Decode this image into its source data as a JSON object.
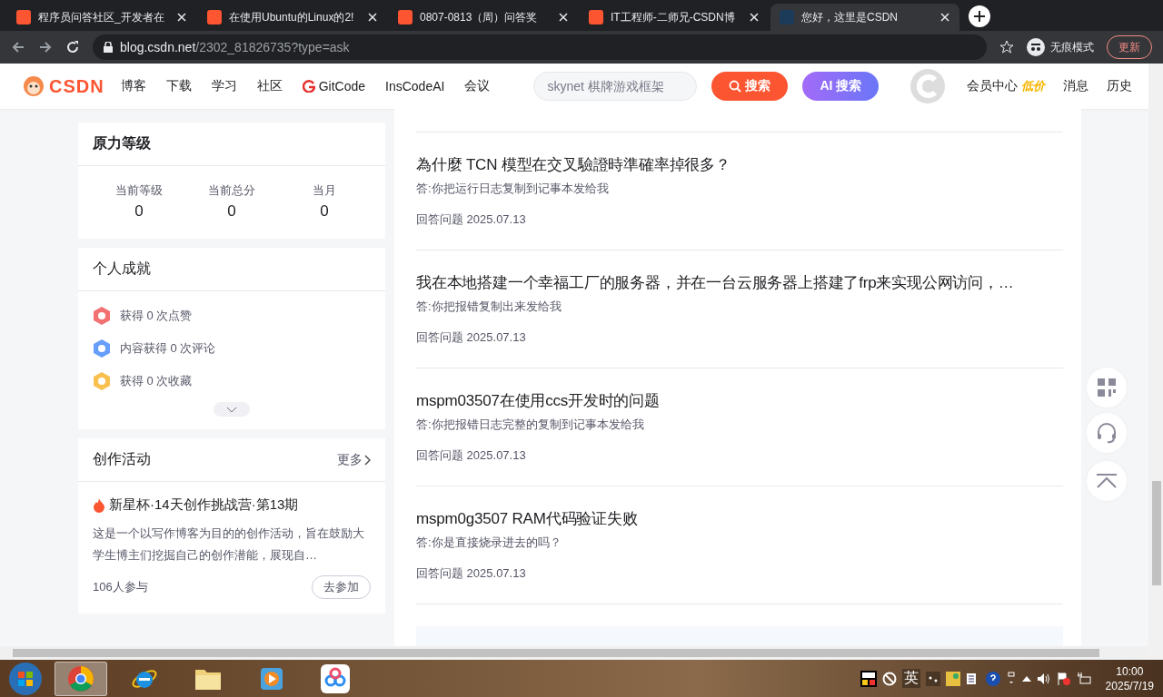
{
  "browser": {
    "tabs": [
      {
        "title": "程序员问答社区_开发者在",
        "selected": false
      },
      {
        "title": "在使用Ubuntu的Linux的2!",
        "selected": false
      },
      {
        "title": "0807-0813（周）问答奖",
        "selected": false
      },
      {
        "title": "IT工程师-二师兄-CSDN博",
        "selected": false
      },
      {
        "title": "您好，这里是CSDN",
        "selected": true
      }
    ],
    "url_host": "blog.csdn.net",
    "url_path": "/2302_81826735?type=ask",
    "incognito_label": "无痕模式",
    "update_label": "更新"
  },
  "header": {
    "logo": "CSDN",
    "nav": [
      {
        "label": "博客",
        "kind": "text"
      },
      {
        "label": "下载",
        "kind": "text"
      },
      {
        "label": "学习",
        "kind": "text"
      },
      {
        "label": "社区",
        "kind": "text"
      },
      {
        "label": "GitCode",
        "kind": "gitcode"
      },
      {
        "label": "InsCodeAI",
        "kind": "text"
      },
      {
        "label": "会议",
        "kind": "text"
      }
    ],
    "search_placeholder": "skynet 棋牌游戏框架",
    "search_button": "搜索",
    "ai_button": "AI 搜索",
    "vip_label": "会员中心",
    "vip_badge": "低价",
    "links": [
      "消息",
      "历史"
    ]
  },
  "level_card": {
    "title": "原力等级",
    "stats": [
      {
        "label": "当前等级",
        "value": "0"
      },
      {
        "label": "当前总分",
        "value": "0"
      },
      {
        "label": "当月",
        "value": "0"
      }
    ]
  },
  "achievements_card": {
    "title": "个人成就",
    "items": [
      {
        "kind": "like",
        "text": "获得 0 次点赞"
      },
      {
        "kind": "comment",
        "text": "内容获得 0 次评论"
      },
      {
        "kind": "favorite",
        "text": "获得 0 次收藏"
      }
    ]
  },
  "activity_card": {
    "title": "创作活动",
    "more": "更多",
    "event_title": "新星杯·14天创作挑战营·第13期",
    "description": "这是一个以写作博客为目的的创作活动，旨在鼓励大学生博主们挖掘自己的创作潜能，展现自…",
    "participants": "106人参与",
    "join_button": "去参加"
  },
  "questions": [
    {
      "title": "為什麼 TCN 模型在交叉驗證時準確率掉很多？",
      "answer": "答:你把运行日志复制到记事本发给我",
      "meta": "回答问题 2025.07.13"
    },
    {
      "title": "我在本地搭建一个幸福工厂的服务器，并在一台云服务器上搭建了frp来实现公网访问，…",
      "answer": "答:你把报错复制出来发给我",
      "meta": "回答问题 2025.07.13"
    },
    {
      "title": "mspm03507在使用ccs开发时的问题",
      "answer": "答:你把报错日志完整的复制到记事本发给我",
      "meta": "回答问题 2025.07.13"
    },
    {
      "title": "mspm0g3507 RAM代码验证失败",
      "answer": "答:你是直接烧录进去的吗？",
      "meta": "回答问题 2025.07.13"
    }
  ],
  "taskbar": {
    "apps": [
      {
        "kind": "chrome",
        "selected": true
      },
      {
        "kind": "ie",
        "selected": false
      },
      {
        "kind": "folder",
        "selected": false
      },
      {
        "kind": "media",
        "selected": false
      },
      {
        "kind": "cloud",
        "selected": false
      }
    ],
    "ime_label": "英",
    "time": "10:00",
    "date": "2025/7/19"
  }
}
